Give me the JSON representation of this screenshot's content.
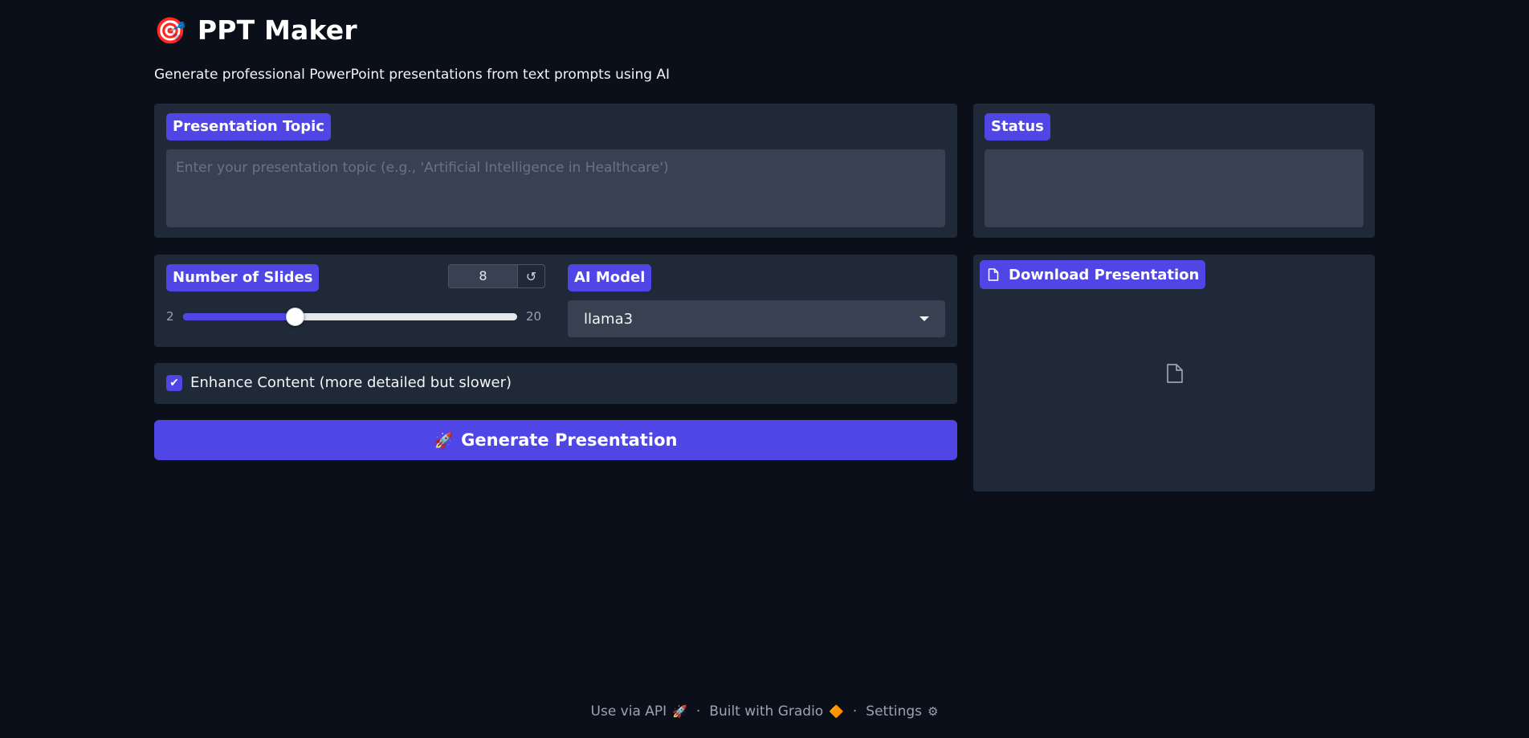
{
  "header": {
    "logo_emoji": "🎯",
    "title": "PPT Maker",
    "subtitle": "Generate professional PowerPoint presentations from text prompts using AI"
  },
  "topic": {
    "label": "Presentation Topic",
    "value": "",
    "placeholder": "Enter your presentation topic (e.g., 'Artificial Intelligence in Healthcare')"
  },
  "status": {
    "label": "Status",
    "value": ""
  },
  "slides": {
    "label": "Number of Slides",
    "value": "8",
    "min": "2",
    "max": "20",
    "reset_icon": "↺"
  },
  "model": {
    "label": "AI Model",
    "selected": "llama3"
  },
  "enhance": {
    "checked": true,
    "check_mark": "✔",
    "label": "Enhance Content (more detailed but slower)"
  },
  "generate": {
    "icon": "🚀",
    "label": "Generate Presentation"
  },
  "download": {
    "label": "Download Presentation"
  },
  "footer": {
    "api": "Use via API",
    "api_icon": "🚀",
    "separator": "·",
    "built": "Built with Gradio",
    "built_icon": "🔶",
    "settings": "Settings",
    "settings_icon": "⚙"
  },
  "colors": {
    "background": "#0b0f19",
    "panel": "#1f2937",
    "input": "#374151",
    "accent": "#4f46e5"
  }
}
